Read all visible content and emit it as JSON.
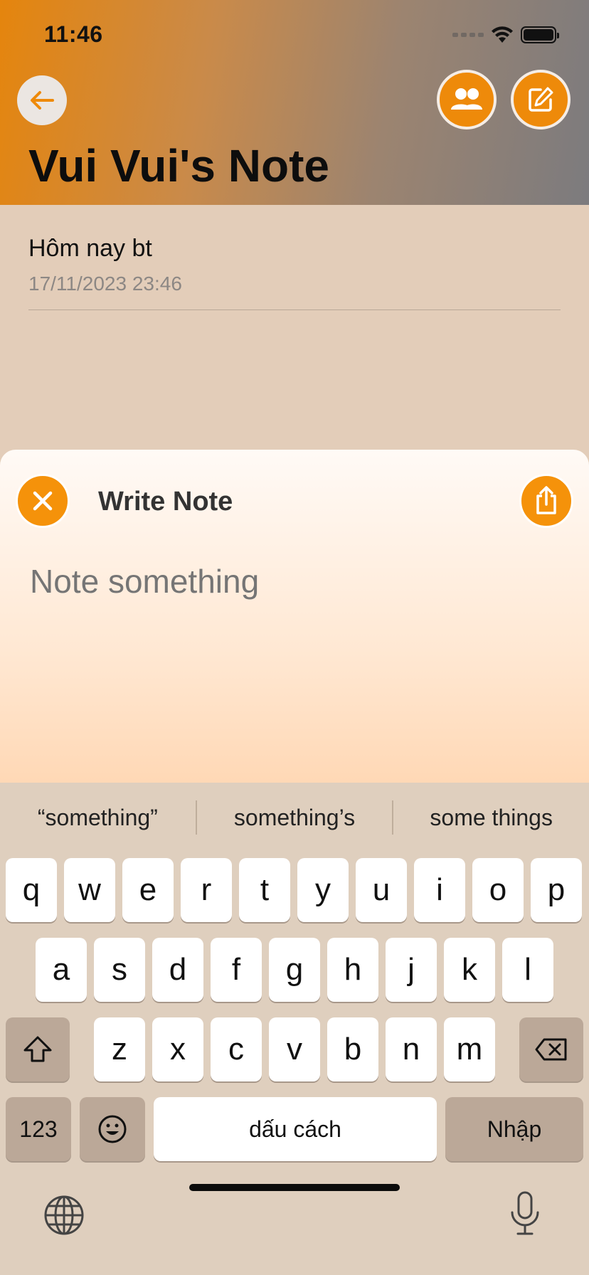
{
  "status_bar": {
    "time": "11:46"
  },
  "header": {
    "title": "Vui Vui's Note"
  },
  "notes": [
    {
      "title": "Hôm nay bt",
      "date": "17/11/2023 23:46"
    }
  ],
  "sheet": {
    "title": "Write Note",
    "input_placeholder": "Note something"
  },
  "keyboard": {
    "suggestions": [
      "“something”",
      "something’s",
      "some things"
    ],
    "row1": [
      "q",
      "w",
      "e",
      "r",
      "t",
      "y",
      "u",
      "i",
      "o",
      "p"
    ],
    "row2": [
      "a",
      "s",
      "d",
      "f",
      "g",
      "h",
      "j",
      "k",
      "l"
    ],
    "row3": [
      "z",
      "x",
      "c",
      "v",
      "b",
      "n",
      "m"
    ],
    "numbers_label": "123",
    "space_label": "dấu cách",
    "return_label": "Nhập"
  },
  "colors": {
    "accent": "#ee8a0a",
    "header_start": "#e5850d",
    "header_end": "#7c7b7e"
  }
}
